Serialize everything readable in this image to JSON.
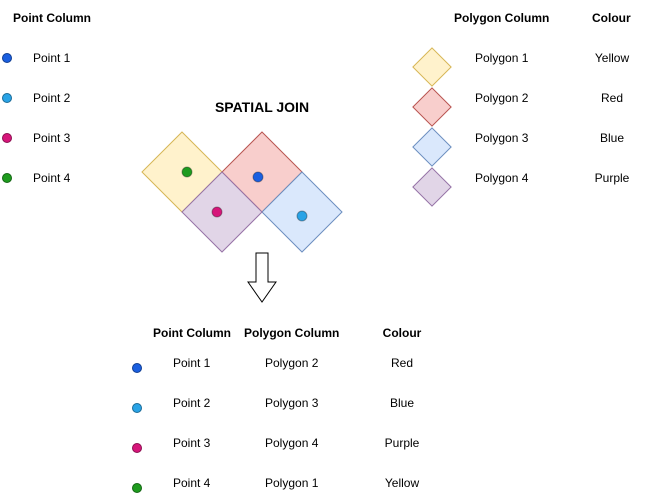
{
  "title": "SPATIAL JOIN",
  "colors": {
    "blue": "#1a5fe0",
    "light_blue": "#29a3e6",
    "magenta": "#d6167a",
    "green": "#1e9b1e",
    "yellow_fill": "#fff2cc",
    "yellow_stroke": "#d6b656",
    "red_fill": "#f8cecc",
    "red_stroke": "#b85450",
    "blue_fill": "#dae8fc",
    "blue_stroke": "#6c8ebf",
    "purple_fill": "#e1d5e7",
    "purple_stroke": "#9673a6"
  },
  "points_table": {
    "header": "Point Column",
    "rows": [
      {
        "label": "Point 1"
      },
      {
        "label": "Point 2"
      },
      {
        "label": "Point 3"
      },
      {
        "label": "Point 4"
      }
    ]
  },
  "polygons_table": {
    "header_polygon": "Polygon Column",
    "header_colour": "Colour",
    "rows": [
      {
        "label": "Polygon 1",
        "colour": "Yellow"
      },
      {
        "label": "Polygon 2",
        "colour": "Red"
      },
      {
        "label": "Polygon 3",
        "colour": "Blue"
      },
      {
        "label": "Polygon 4",
        "colour": "Purple"
      }
    ]
  },
  "result_table": {
    "header_point": "Point Column",
    "header_polygon": "Polygon Column",
    "header_colour": "Colour",
    "rows": [
      {
        "point": "Point 1",
        "polygon": "Polygon 2",
        "colour": "Red"
      },
      {
        "point": "Point 2",
        "polygon": "Polygon 3",
        "colour": "Blue"
      },
      {
        "point": "Point 3",
        "polygon": "Polygon 4",
        "colour": "Purple"
      },
      {
        "point": "Point 4",
        "polygon": "Polygon 1",
        "colour": "Yellow"
      }
    ]
  }
}
